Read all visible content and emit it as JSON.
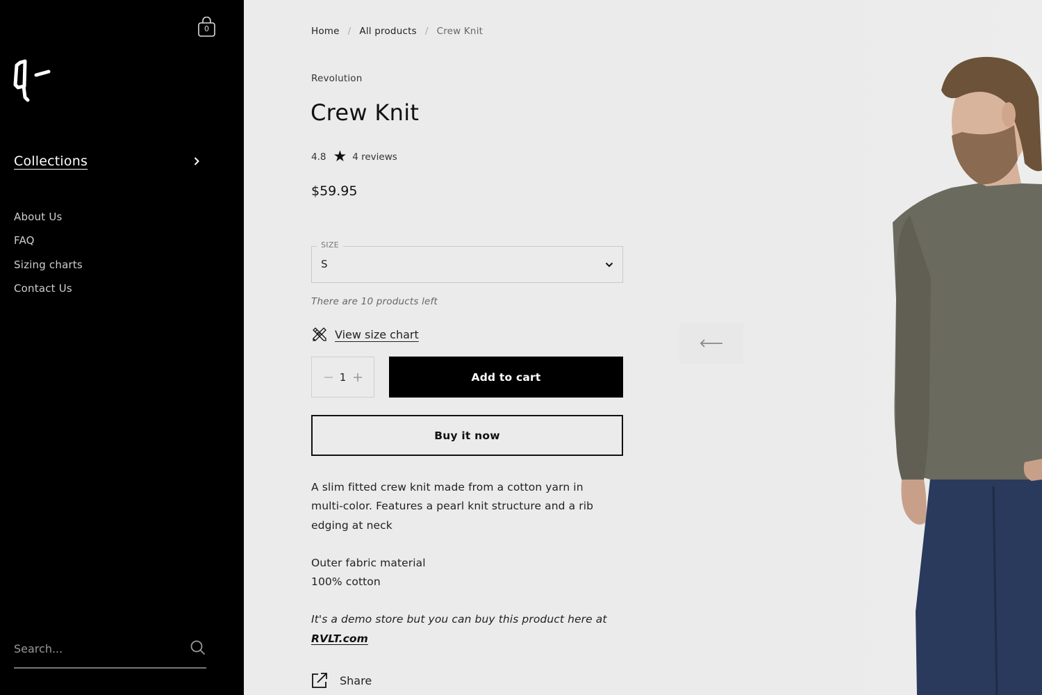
{
  "sidebar": {
    "cart_count": "0",
    "logo_alt": "q-",
    "collections_label": "Collections",
    "nav_items": [
      {
        "label": "About Us"
      },
      {
        "label": "FAQ"
      },
      {
        "label": "Sizing charts"
      },
      {
        "label": "Contact Us"
      }
    ],
    "search_placeholder": "Search..."
  },
  "breadcrumb": {
    "items": [
      "Home",
      "All products",
      "Crew Knit"
    ],
    "separator": "/"
  },
  "product": {
    "vendor": "Revolution",
    "title": "Crew Knit",
    "rating": "4.8",
    "reviews": "4 reviews",
    "price": "$59.95",
    "size_label": "SIZE",
    "size_value": "S",
    "stock_text": "There are 10 products left",
    "size_chart_label": "View size chart",
    "quantity": "1",
    "add_to_cart": "Add to cart",
    "buy_now": "Buy it now",
    "description": [
      "A slim fitted crew knit made from a cotton yarn in multi-color. Features a pearl knit structure and a rib edging at neck"
    ],
    "material_heading": "Outer fabric material",
    "material_value": "100% cotton",
    "demo_note_prefix": "It's a demo store but you can buy this product here at ",
    "demo_link": "RVLT.com",
    "share_label": "Share"
  },
  "icons": {
    "cart": "shopping-bag-icon",
    "chevron": "chevron-right-icon",
    "search": "search-icon",
    "star": "★",
    "ruler": "ruler-pencil-icon",
    "share": "external-link-icon",
    "arrow": "arrow-left-icon"
  },
  "colors": {
    "sidebar_bg": "#000000",
    "page_bg": "#ebebeb",
    "primary_button": "#000000",
    "sweater": "#6b6a5e",
    "jeans": "#2a3a5c"
  }
}
